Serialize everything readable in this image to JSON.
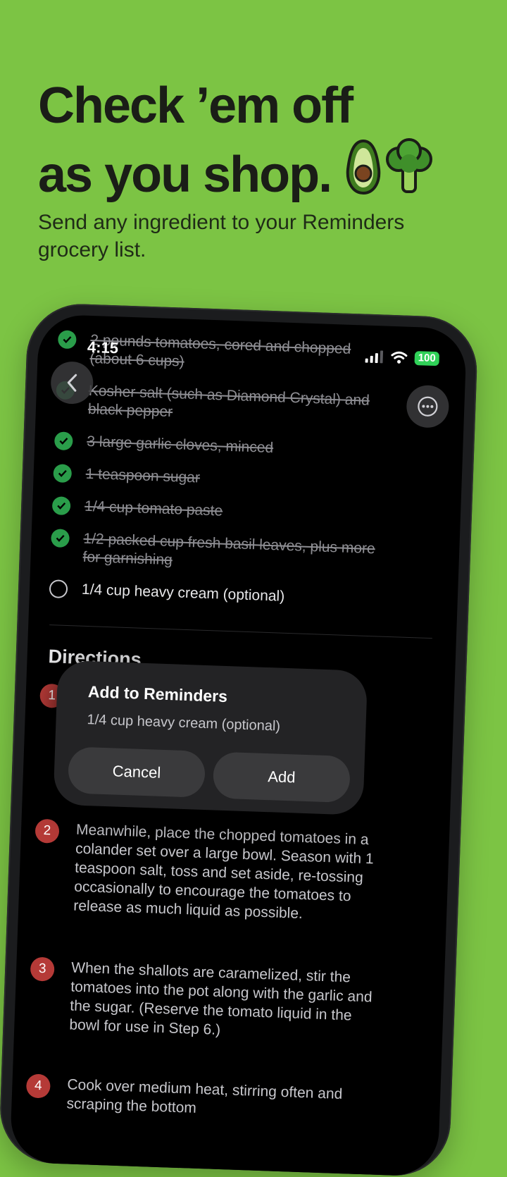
{
  "headline": {
    "line1": "Check ’em off",
    "line2": "as you shop."
  },
  "subtitle": "Send any ingredient to your Reminders grocery list.",
  "status": {
    "time": "4:15",
    "battery": "100"
  },
  "ingredients": [
    {
      "text": "2 pounds tomatoes, cored and chopped (about 6 cups)",
      "checked": true
    },
    {
      "text": "Kosher salt (such as Diamond Crystal) and black pepper",
      "checked": true
    },
    {
      "text": "3 large garlic cloves, minced",
      "checked": true
    },
    {
      "text": "1 teaspoon sugar",
      "checked": true
    },
    {
      "text": "1/4 cup tomato paste",
      "checked": true
    },
    {
      "text": "1/2 packed cup fresh basil leaves, plus more for garnishing",
      "checked": true
    },
    {
      "text": "1/4 cup heavy cream (optional)",
      "checked": false
    }
  ],
  "directions": {
    "title": "Directions",
    "steps": [
      {
        "num": "1",
        "text": ""
      },
      {
        "num": "2",
        "text": "Meanwhile, place the chopped tomatoes in a colander set over a large bowl. Season with 1 teaspoon salt, toss and set aside, re-tossing occasionally to encourage the tomatoes to release as much liquid as possible."
      },
      {
        "num": "3",
        "text": "When the shallots are caramelized, stir the tomatoes into the pot along with the garlic and the sugar. (Reserve the tomato liquid in the bowl for use in Step 6.)"
      },
      {
        "num": "4",
        "text": "Cook over medium heat, stirring often and scraping the bottom"
      }
    ]
  },
  "dialog": {
    "title": "Add to Reminders",
    "message": "1/4 cup heavy cream (optional)",
    "cancel": "Cancel",
    "add": "Add"
  },
  "colors": {
    "background": "#7cc444",
    "check": "#2a9d4a",
    "step_badge": "#b53a37"
  }
}
